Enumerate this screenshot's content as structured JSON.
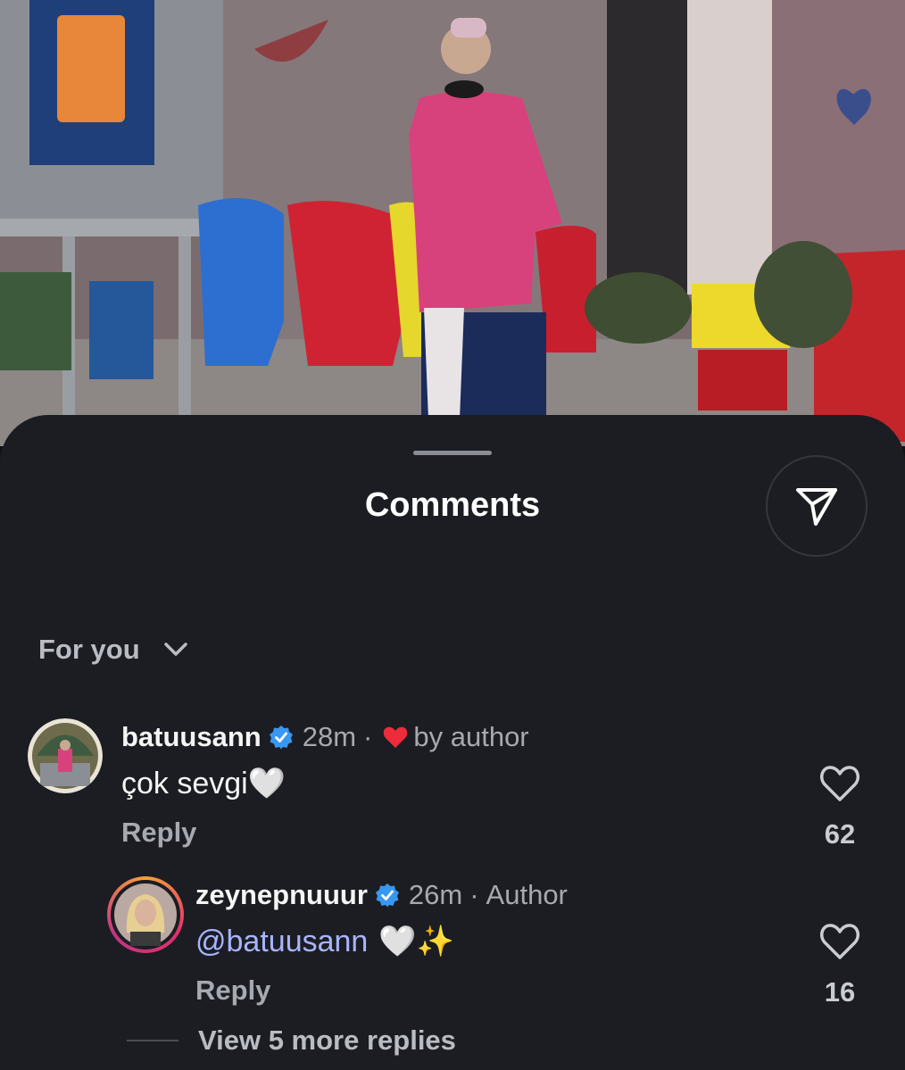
{
  "colors": {
    "sheet_background": "#1b1d22",
    "meta_text": "#a6a9b0",
    "mention": "#a8b4ff",
    "verified_badge": "#3897f0",
    "author_heart": "#ed2b3b"
  },
  "sheet": {
    "title": "Comments",
    "share_icon": "paper-plane-icon",
    "filter": {
      "label": "For you",
      "icon": "chevron-down-icon"
    }
  },
  "comments": [
    {
      "username": "batuusann",
      "verified": true,
      "time": "28m",
      "separator": "·",
      "badge_icon": "red-heart-icon",
      "badge_text": "by author",
      "text": "çok sevgi🤍",
      "reply_label": "Reply",
      "like_icon": "heart-outline-icon",
      "likes": "62"
    },
    {
      "username": "zeynepnuuur",
      "verified": true,
      "time": "26m",
      "separator": "·",
      "badge_text": "Author",
      "mention": "@batuusann",
      "text": "🤍✨",
      "reply_label": "Reply",
      "like_icon": "heart-outline-icon",
      "likes": "16"
    }
  ],
  "view_more_replies": "View 5 more replies"
}
